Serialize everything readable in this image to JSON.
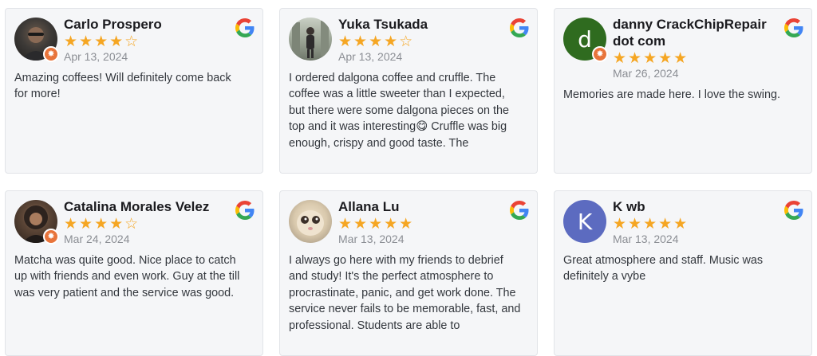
{
  "reviews": [
    {
      "name": "Carlo Prospero",
      "stars_display": "★★★★☆",
      "rating": 4,
      "date": "Apr 13, 2024",
      "text": "Amazing coffees! Will definitely come back for more!",
      "avatar": {
        "type": "photo",
        "color": "#3d3a37"
      }
    },
    {
      "name": "Yuka Tsukada",
      "stars_display": "★★★★☆",
      "rating": 4,
      "date": "Apr 13, 2024",
      "text": "I ordered dalgona coffee and cruffle. The coffee was a little sweeter than I expected, but there were some dalgona pieces on the top and it was interesting😋 Cruffle was big enough, crispy and good taste. The",
      "avatar": {
        "type": "photo",
        "color": "#8a9185"
      }
    },
    {
      "name": "danny CrackChipRepair dot com",
      "stars_display": "★★★★★",
      "rating": 5,
      "date": "Mar 26, 2024",
      "text": "Memories are made here. I love the swing.",
      "avatar": {
        "type": "letter",
        "letter": "d",
        "color": "#2f6b1f"
      }
    },
    {
      "name": "Catalina Morales Velez",
      "stars_display": "★★★★☆",
      "rating": 4,
      "date": "Mar 24, 2024",
      "text": "Matcha was quite good. Nice place to catch up with friends and even work. Guy at the till was very patient and the service was good.",
      "avatar": {
        "type": "photo",
        "color": "#4a3b31"
      }
    },
    {
      "name": "Allana Lu",
      "stars_display": "★★★★★",
      "rating": 5,
      "date": "Mar 13, 2024",
      "text": "I always go here with my friends to debrief and study! It's the perfect atmosphere to procrastinate, panic, and get work done. The service never fails to be memorable, fast, and professional. Students are able to",
      "avatar": {
        "type": "photo",
        "color": "#d9c9ad"
      }
    },
    {
      "name": "K wb",
      "stars_display": "★★★★★",
      "rating": 5,
      "date": "Mar 13, 2024",
      "text": "Great atmosphere and staff. Music was definitely a vybe",
      "avatar": {
        "type": "letter",
        "letter": "K",
        "color": "#5c6bc0"
      }
    }
  ],
  "colors": {
    "star": "#f5a623",
    "badge": "#e8743b",
    "card_bg": "#f5f6f8"
  },
  "icons": {
    "source": "google-g-icon",
    "badge": "local-guide-badge-icon"
  }
}
